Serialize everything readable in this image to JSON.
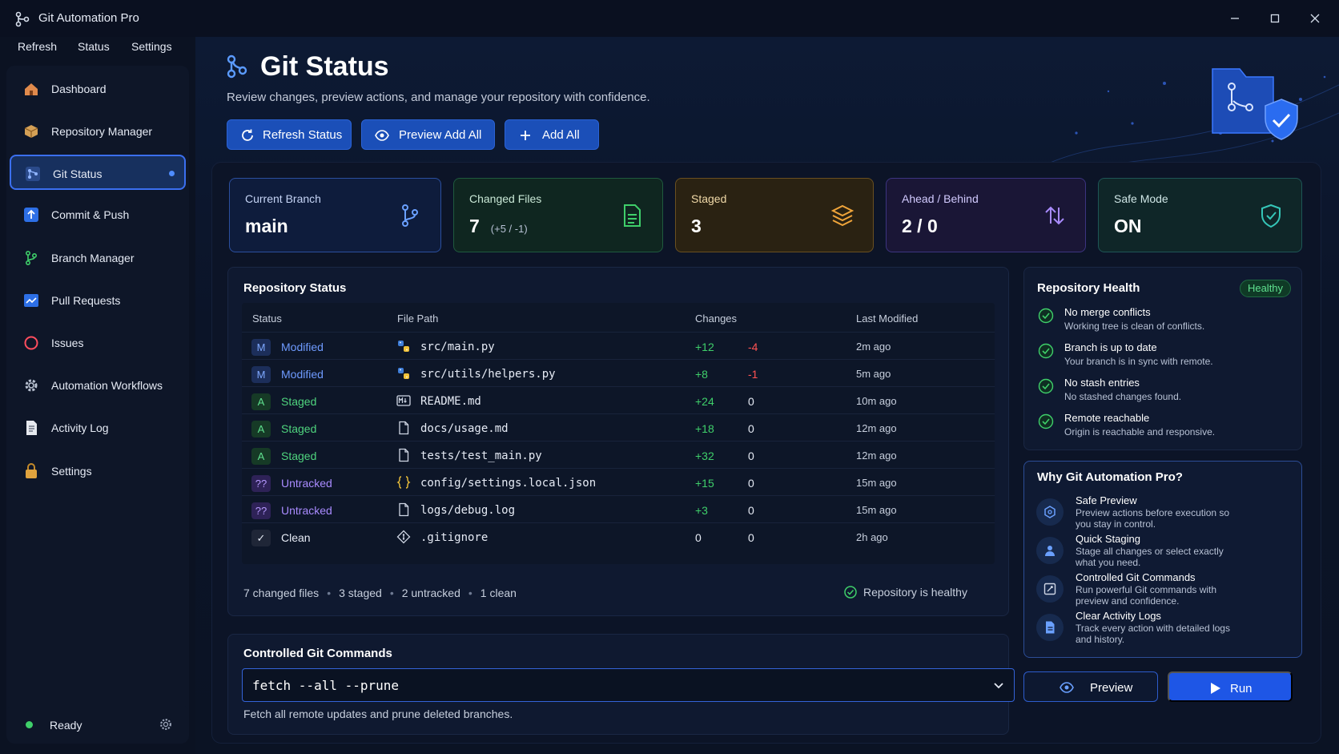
{
  "app": {
    "title": "Git Automation Pro"
  },
  "menu": [
    "Refresh",
    "Status",
    "Settings"
  ],
  "sidebar": {
    "items": [
      {
        "label": "Dashboard",
        "icon": "home-icon"
      },
      {
        "label": "Repository Manager",
        "icon": "box-icon"
      },
      {
        "label": "Git Status",
        "icon": "git-status-icon",
        "active": true
      },
      {
        "label": "Commit & Push",
        "icon": "upload-icon"
      },
      {
        "label": "Branch Manager",
        "icon": "branch-icon"
      },
      {
        "label": "Pull Requests",
        "icon": "pull-request-icon"
      },
      {
        "label": "Issues",
        "icon": "issue-circle-icon"
      },
      {
        "label": "Automation Workflows",
        "icon": "gear-icon"
      },
      {
        "label": "Activity Log",
        "icon": "document-icon"
      },
      {
        "label": "Settings",
        "icon": "lock-icon"
      }
    ],
    "status": "Ready"
  },
  "header": {
    "title": "Git Status",
    "subtitle": "Review changes, preview actions, and manage your repository with confidence.",
    "buttons": {
      "refresh": "Refresh Status",
      "preview_add": "Preview Add All",
      "add_all": "Add All"
    }
  },
  "stats": {
    "branch": {
      "label": "Current Branch",
      "value": "main"
    },
    "changed": {
      "label": "Changed Files",
      "value": "7",
      "sub": "(+5 / -1)"
    },
    "staged": {
      "label": "Staged",
      "value": "3"
    },
    "ahead": {
      "label": "Ahead / Behind",
      "value": "2 / 0"
    },
    "safe": {
      "label": "Safe Mode",
      "value": "ON"
    }
  },
  "repo_status": {
    "title": "Repository Status",
    "columns": [
      "Status",
      "File Path",
      "Changes",
      "Last Modified"
    ],
    "rows": [
      {
        "badge": "M",
        "status": "Modified",
        "path": "src/main.py",
        "plus": "+12",
        "minus": "-4",
        "time": "2m ago",
        "kind": "modified",
        "icon": "python-icon"
      },
      {
        "badge": "M",
        "status": "Modified",
        "path": "src/utils/helpers.py",
        "plus": "+8",
        "minus": "-1",
        "time": "5m ago",
        "kind": "modified",
        "icon": "python-icon"
      },
      {
        "badge": "A",
        "status": "Staged",
        "path": "README.md",
        "plus": "+24",
        "minus": "0",
        "time": "10m ago",
        "kind": "staged",
        "icon": "markdown-icon"
      },
      {
        "badge": "A",
        "status": "Staged",
        "path": "docs/usage.md",
        "plus": "+18",
        "minus": "0",
        "time": "12m ago",
        "kind": "staged",
        "icon": "file-icon"
      },
      {
        "badge": "A",
        "status": "Staged",
        "path": "tests/test_main.py",
        "plus": "+32",
        "minus": "0",
        "time": "12m ago",
        "kind": "staged",
        "icon": "file-icon"
      },
      {
        "badge": "??",
        "status": "Untracked",
        "path": "config/settings.local.json",
        "plus": "+15",
        "minus": "0",
        "time": "15m ago",
        "kind": "untracked",
        "icon": "json-icon"
      },
      {
        "badge": "??",
        "status": "Untracked",
        "path": "logs/debug.log",
        "plus": "+3",
        "minus": "0",
        "time": "15m ago",
        "kind": "untracked",
        "icon": "file-icon"
      },
      {
        "badge": "✓",
        "status": "Clean",
        "path": ".gitignore",
        "plus": "0",
        "minus": "0",
        "time": "2h ago",
        "kind": "clean",
        "icon": "git-diamond-icon"
      }
    ],
    "summary": [
      "7 changed files",
      "3 staged",
      "2 untracked",
      "1 clean"
    ],
    "healthy_note": "Repository is healthy"
  },
  "health": {
    "title": "Repository Health",
    "badge": "Healthy",
    "items": [
      {
        "title": "No merge conflicts",
        "desc": "Working tree is clean of conflicts."
      },
      {
        "title": "Branch is up to date",
        "desc": "Your branch is in sync with remote."
      },
      {
        "title": "No stash entries",
        "desc": "No stashed changes found."
      },
      {
        "title": "Remote reachable",
        "desc": "Origin is reachable and responsive."
      }
    ]
  },
  "why": {
    "title": "Why Git Automation Pro?",
    "items": [
      {
        "title": "Safe Preview",
        "desc": "Preview actions before execution so you stay in control.",
        "icon": "hexagon-shield-icon"
      },
      {
        "title": "Quick Staging",
        "desc": "Stage all changes or select exactly what you need.",
        "icon": "stage-user-icon"
      },
      {
        "title": "Controlled Git Commands",
        "desc": "Run powerful Git commands with preview and confidence.",
        "icon": "edit-square-icon"
      },
      {
        "title": "Clear Activity Logs",
        "desc": "Track every action with detailed logs and history.",
        "icon": "log-document-icon"
      }
    ]
  },
  "commands": {
    "title": "Controlled Git Commands",
    "value": "fetch --all --prune",
    "desc": "Fetch all remote updates and prune deleted branches.",
    "preview": "Preview",
    "run": "Run"
  },
  "colors": {
    "accent": "#1e56e6",
    "modified": "#5b8dff",
    "staged": "#3fcf6a",
    "untracked": "#a779ff",
    "deletion": "#ff5252"
  }
}
